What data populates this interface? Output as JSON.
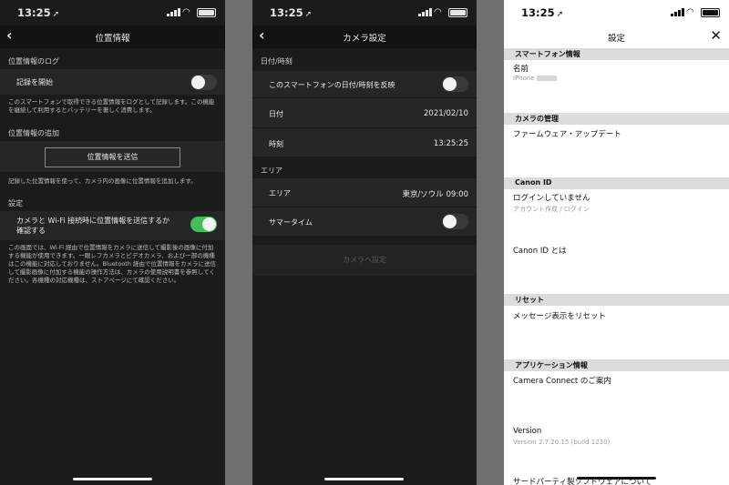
{
  "status": {
    "time": "13:25",
    "arrow": "➚"
  },
  "panel1": {
    "title": "位置情報",
    "sec1": "位置情報のログ",
    "record_label": "記録を開始",
    "record_on": false,
    "note1": "このスマートフォンで取得できる位置情報をログとして記録します。この機能を継続して利用するとバッテリーを著しく消費します。",
    "sec2": "位置情報の追加",
    "send_button": "位置情報を送信",
    "note2": "記録した位置情報を使って、カメラ内の画像に位置情報を追加します。",
    "sec3": "設定",
    "wifi_label": "カメラと Wi-Fi 接続時に位置情報を送信するか確認する",
    "wifi_on": true,
    "note3": "この画面では、Wi-Fi 経由で位置情報をカメラに送信して撮影後の画像に付加する機能が使用できます。一眼レフカメラとビデオカメラ、および一部の機種はこの機能に対応しておりません。Bluetooth 経由で位置情報をカメラに送信して撮影画像に付加する機能の操作方法は、カメラの使用説明書を参照してください。各機種の対応機種は、ストアページにて確認ください。"
  },
  "panel2": {
    "title": "カメラ設定",
    "sec1": "日付/時刻",
    "sync_label": "このスマートフォンの日付/時刻を反映",
    "sync_on": false,
    "date_label": "日付",
    "date_value": "2021/02/10",
    "time_label": "時刻",
    "time_value": "13:25:25",
    "sec2": "エリア",
    "area_label": "エリア",
    "area_value": "東京/ソウル 09:00",
    "summer_label": "サマータイム",
    "summer_on": false,
    "apply_button": "カメラへ設定"
  },
  "panel3": {
    "title": "設定",
    "sec_smartphone": "スマートフォン情報",
    "name_label": "名前",
    "name_value": "iPhone",
    "sec_camera": "カメラの管理",
    "firmware": "ファームウェア・アップデート",
    "sec_canonid": "Canon ID",
    "login_label": "ログインしていません",
    "login_sub": "アカウント作成 / ログイン",
    "about_canonid": "Canon ID とは",
    "sec_reset": "リセット",
    "reset_msg": "メッセージ表示をリセット",
    "sec_app": "アプリケーション情報",
    "guide": "Camera Connect のご案内",
    "version_label": "Version",
    "version_value": "Version 2.7.20.15 (build 1230)",
    "third_party": "サードパーティ製ソフトウェアについて"
  },
  "colors": {
    "toggle_on": "#3fbf57",
    "dark_bg": "#1b1b1b",
    "cell_bg": "#262626",
    "section_light": "#dcdcdc"
  }
}
